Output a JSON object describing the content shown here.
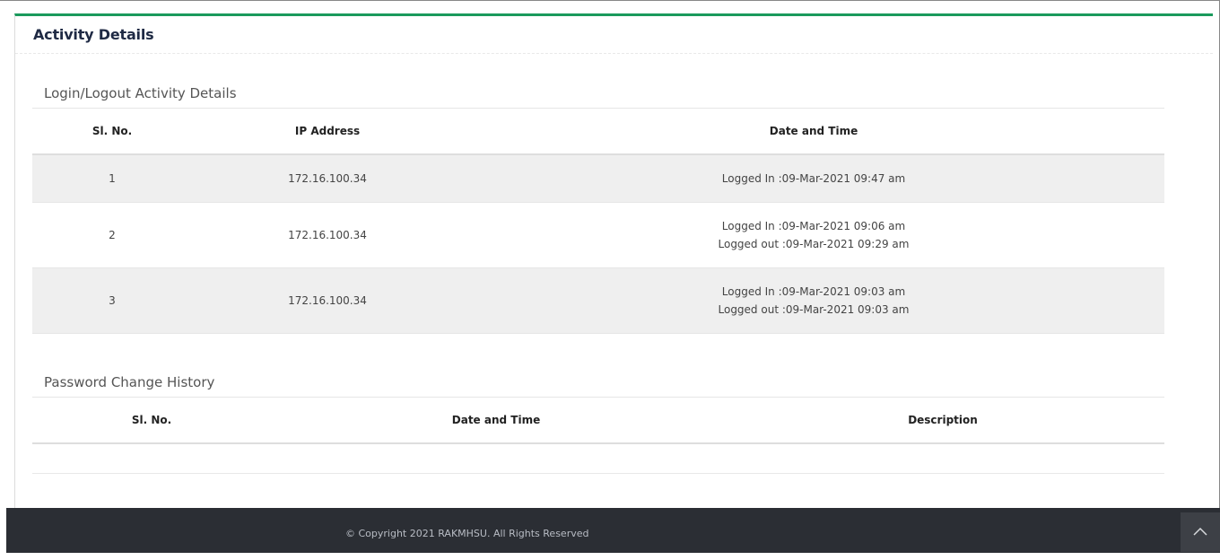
{
  "card": {
    "title": "Activity Details"
  },
  "login_section": {
    "title": "Login/Logout Activity Details",
    "columns": [
      "Sl. No.",
      "IP Address",
      "Date and Time"
    ],
    "rows": [
      {
        "sl": "1",
        "ip": "172.16.100.34",
        "logged_in": "Logged In :09-Mar-2021 09:47 am",
        "logged_out": ""
      },
      {
        "sl": "2",
        "ip": "172.16.100.34",
        "logged_in": "Logged In :09-Mar-2021 09:06 am",
        "logged_out": "Logged out :09-Mar-2021 09:29 am"
      },
      {
        "sl": "3",
        "ip": "172.16.100.34",
        "logged_in": "Logged In :09-Mar-2021 09:03 am",
        "logged_out": "Logged out :09-Mar-2021 09:03 am"
      }
    ]
  },
  "password_section": {
    "title": "Password Change History",
    "columns": [
      "Sl. No.",
      "Date and Time",
      "Description"
    ]
  },
  "footer": {
    "copyright": "© Copyright 2021 RAKMHSU. All Rights Reserved"
  },
  "icons": {
    "scroll_top": "chevron-up-icon"
  },
  "colors": {
    "accent": "#1a9a5c",
    "footer_bg": "#2b2e34"
  }
}
